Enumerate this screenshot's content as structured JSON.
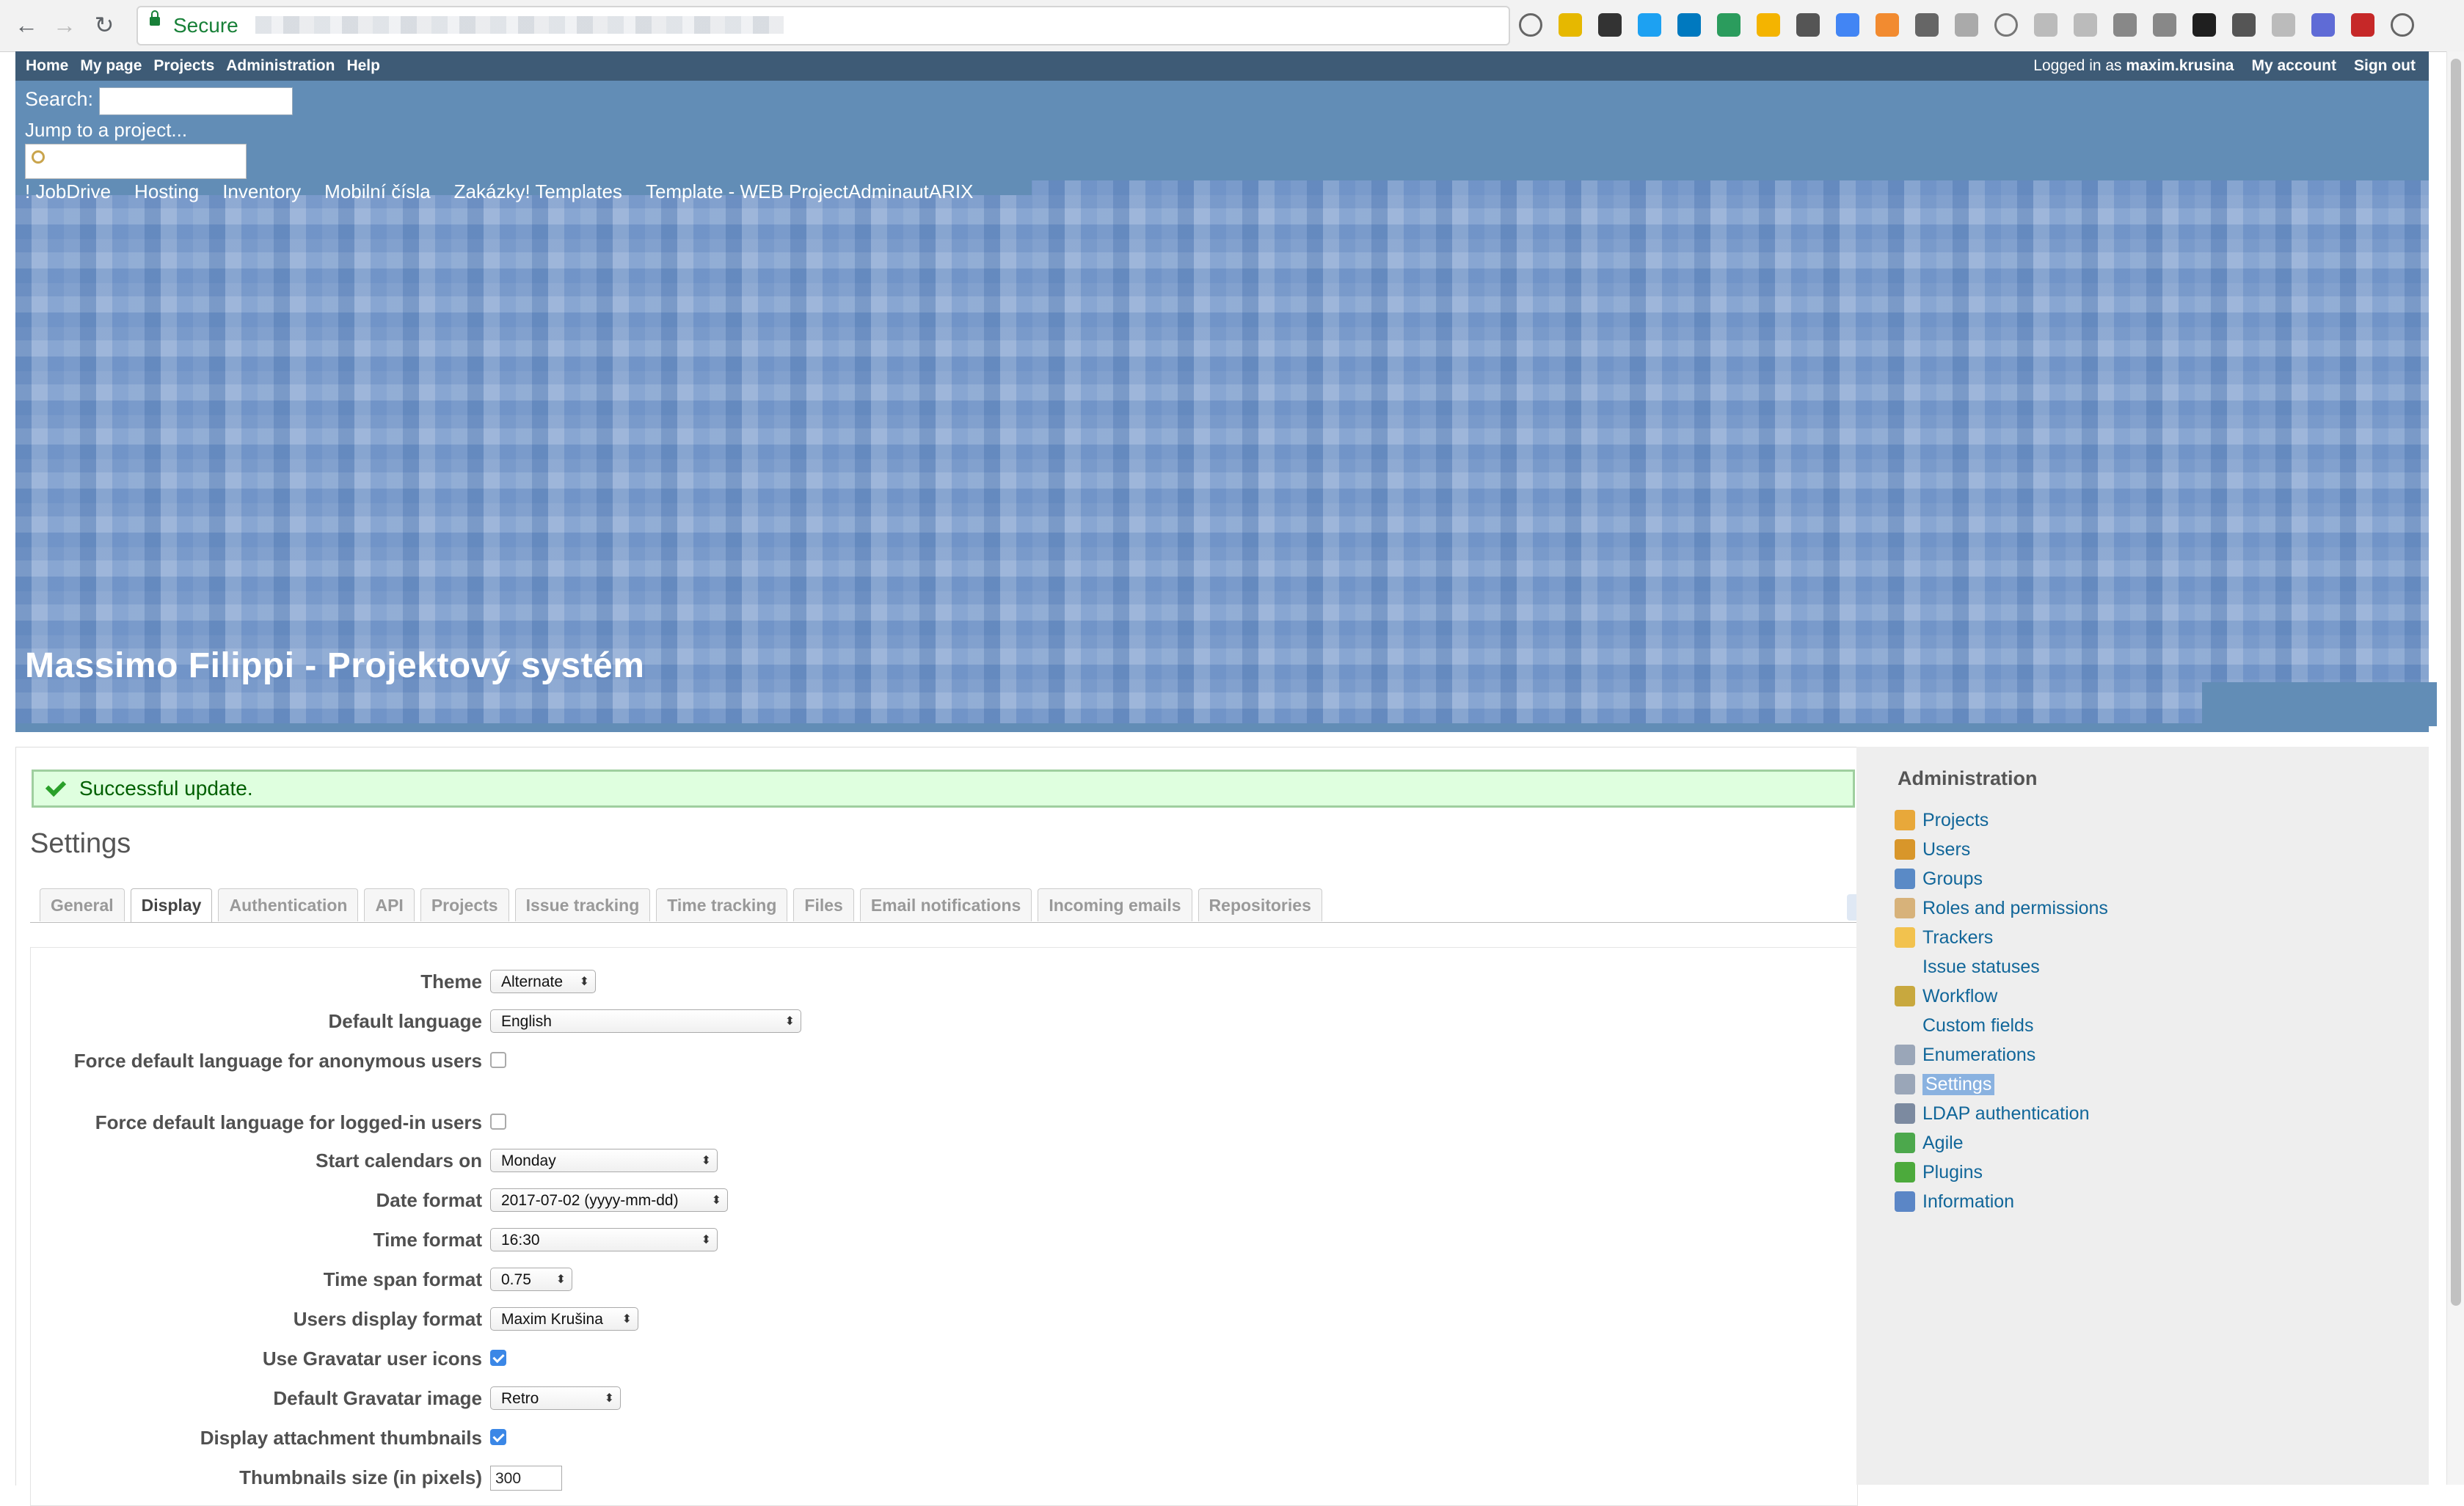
{
  "browser": {
    "secure_label": "Secure",
    "extension_icons": [
      "info-icon",
      "ublock-icon",
      "evernote-icon",
      "plus-icon",
      "trello-icon",
      "vpn-off-icon",
      "drive-icon",
      "pocket-icon",
      "translate-icon",
      "chart-icon",
      "sync-icon",
      "reader-icon",
      "star-icon",
      "chat-icon",
      "cloud-icon",
      "layout-icon",
      "zotero-icon",
      "keep-icon",
      "lightbulb-icon",
      "code-icon",
      "profile-icon",
      "mouse-icon",
      "menu-icon"
    ],
    "extension_colors": [
      "#666",
      "#e6b800",
      "#333",
      "#1da1f2",
      "#0079bf",
      "#2b9c5d",
      "#f4b400",
      "#555",
      "#4285f4",
      "#f28b30",
      "#666",
      "#aaa",
      "#777",
      "#bbb",
      "#bbb",
      "#888",
      "#888",
      "#1f1f1f",
      "#555",
      "#bbb",
      "#5f6bd6",
      "#c62828",
      "#666"
    ]
  },
  "top_menu": {
    "left": [
      "Home",
      "My page",
      "Projects",
      "Administration",
      "Help"
    ],
    "logged_prefix": "Logged in as",
    "user": "maxim.krusina",
    "my_account": "My account",
    "sign_out": "Sign out"
  },
  "header": {
    "search_label": "Search:",
    "jump_label": "Jump to a project...",
    "quick_projects": [
      "! JobDrive",
      "Hosting",
      "Inventory",
      "Mobilní čísla",
      "Zakázky! Templates",
      "Template - WEB ProjectAdminautARIX"
    ],
    "title": "Massimo Filippi - Projektový systém"
  },
  "flash": {
    "message": "Successful update."
  },
  "settings": {
    "title": "Settings",
    "tabs": [
      "General",
      "Display",
      "Authentication",
      "API",
      "Projects",
      "Issue tracking",
      "Time tracking",
      "Files",
      "Email notifications",
      "Incoming emails",
      "Repositories"
    ],
    "active_tab": "Display",
    "fields": [
      {
        "label": "Theme",
        "type": "select",
        "value": "Alternate"
      },
      {
        "label": "Default language",
        "type": "select",
        "value": "English"
      },
      {
        "label": "Force default language for anonymous users",
        "type": "checkbox",
        "checked": false
      },
      {
        "label": "Force default language for logged-in users",
        "type": "checkbox",
        "checked": false
      },
      {
        "label": "Start calendars on",
        "type": "select",
        "value": "Monday"
      },
      {
        "label": "Date format",
        "type": "select",
        "value": "2017-07-02 (yyyy-mm-dd)"
      },
      {
        "label": "Time format",
        "type": "select",
        "value": "16:30"
      },
      {
        "label": "Time span format",
        "type": "select",
        "value": "0.75"
      },
      {
        "label": "Users display format",
        "type": "select",
        "value": "Maxim Krušina"
      },
      {
        "label": "Use Gravatar user icons",
        "type": "checkbox",
        "checked": true
      },
      {
        "label": "Default Gravatar image",
        "type": "select",
        "value": "Retro"
      },
      {
        "label": "Display attachment thumbnails",
        "type": "checkbox",
        "checked": true
      },
      {
        "label": "Thumbnails size (in pixels)",
        "type": "text",
        "value": "300"
      }
    ]
  },
  "sidebar": {
    "title": "Administration",
    "items": [
      {
        "label": "Projects",
        "icon": "projects-icon",
        "color": "#e8a83a"
      },
      {
        "label": "Users",
        "icon": "user-icon",
        "color": "#d8962a"
      },
      {
        "label": "Groups",
        "icon": "group-icon",
        "color": "#5a8ac6"
      },
      {
        "label": "Roles and permissions",
        "icon": "key-icon",
        "color": "#d7b27a"
      },
      {
        "label": "Trackers",
        "icon": "folder-icon",
        "color": "#f2c24e"
      },
      {
        "label": "Issue statuses",
        "icon": "",
        "color": ""
      },
      {
        "label": "Workflow",
        "icon": "workflow-icon",
        "color": "#c8a83e"
      },
      {
        "label": "Custom fields",
        "icon": "",
        "color": ""
      },
      {
        "label": "Enumerations",
        "icon": "list-icon",
        "color": "#9aa6b8"
      },
      {
        "label": "Settings",
        "icon": "gear-icon",
        "color": "#9aa6b8",
        "selected": true
      },
      {
        "label": "LDAP authentication",
        "icon": "server-icon",
        "color": "#7c8aa0"
      },
      {
        "label": "Agile",
        "icon": "agile-icon",
        "color": "#4ca84c"
      },
      {
        "label": "Plugins",
        "icon": "plugin-icon",
        "color": "#4caa3c"
      },
      {
        "label": "Information",
        "icon": "info-icon",
        "color": "#5b86c6"
      }
    ]
  }
}
